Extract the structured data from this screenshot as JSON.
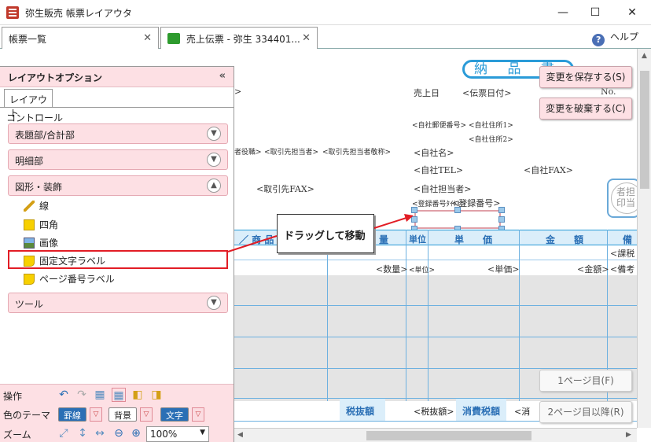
{
  "window": {
    "title": "弥生販売 帳票レイアウタ",
    "minimize": "—",
    "maximize": "☐",
    "close": "✕"
  },
  "tabs": [
    {
      "label": "帳票一覧"
    },
    {
      "label": "売上伝票 - 弥生 334401..."
    }
  ],
  "help": {
    "label": "ヘルプ",
    "icon": "?"
  },
  "layout_panel": {
    "title": "レイアウトオプション",
    "collapse": "«",
    "subtab": "レイアウト",
    "section": "コントロール",
    "groups": {
      "header_footer": "表題部/合計部",
      "detail": "明細部",
      "shapes": "図形・装飾",
      "tools": "ツール"
    },
    "controls": {
      "line": "線",
      "rect": "四角",
      "image": "画像",
      "fixed_label": "固定文字ラベル",
      "page_label": "ページ番号ラベル"
    }
  },
  "bottom_bar": {
    "operations_label": "操作",
    "color_theme_label": "色のテーマ",
    "zoom_label": "ズーム",
    "chip_grid": "罫線",
    "chip_bg": "背景",
    "chip_text": "文字",
    "zoom_value": "100%"
  },
  "canvas": {
    "doc_title": "納 品 書",
    "fields": {
      "arrow": ">",
      "sales_date": "売上日",
      "slip_date": "<伝票日付>",
      "no": "No.",
      "own_zip": "<自社郵便番号>",
      "own_addr1": "<自社住所1>",
      "own_addr2": "<自社住所2>",
      "client_role": "者役職>",
      "client_person": "<取引先担当者>",
      "client_person_title": "<取引先担当者敬称>",
      "own_name": "<自社名>",
      "own_tel": "<自社TEL>",
      "own_fax": "<自社FAX>",
      "client_fax": "<取引先FAX>",
      "own_person": "<自社担当者>",
      "reg_title": "<登録番号ﾀｲﾄﾙ>",
      "reg_no": "<登録番号>",
      "stamp_text": "者担\n印当"
    },
    "table_headers": {
      "product": "／ 商 品",
      "qty": "量",
      "unit": "単位",
      "price": "単　　価",
      "amount": "金　　額",
      "note": "備"
    },
    "row_values": {
      "tax_class": "<課税",
      "qty": "<数量>",
      "unit": "<単位>",
      "price": "<単価>",
      "amount": "<金額>",
      "note": "<備考"
    },
    "summary": {
      "tax_excl_label": "税抜額",
      "tax_excl_value": "<税抜額>",
      "tax_label": "消費税額",
      "tax_value": "<消"
    }
  },
  "callout": {
    "text": "ドラッグして移動"
  },
  "buttons": {
    "save": "変更を保存する(S)",
    "discard": "変更を破棄する(C)",
    "page1": "1ページ目(F)",
    "page2": "2ページ目以降(R)"
  },
  "colors": {
    "accent_blue": "#2a9bd8",
    "highlight_red": "#e21d25",
    "panel_pink": "#fde0e4"
  }
}
